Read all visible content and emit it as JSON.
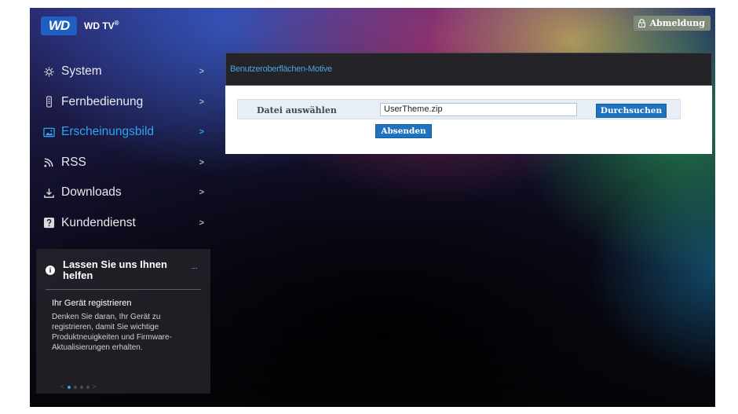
{
  "header": {
    "logo_text": "WD",
    "brand": "WD TV",
    "brand_mark": "®",
    "logout_label": "Abmeldung",
    "logout_icon": "lock-icon"
  },
  "nav": {
    "items": [
      {
        "label": "System",
        "icon": "gear-icon",
        "active": false
      },
      {
        "label": "Fernbedienung",
        "icon": "remote-icon",
        "active": false
      },
      {
        "label": "Erscheinungsbild",
        "icon": "image-icon",
        "active": true
      },
      {
        "label": "RSS",
        "icon": "rss-icon",
        "active": false
      },
      {
        "label": "Downloads",
        "icon": "download-icon",
        "active": false
      },
      {
        "label": "Kundendienst",
        "icon": "help-icon",
        "active": false
      }
    ],
    "chevron": ">"
  },
  "help_box": {
    "title": "Lassen Sie uns Ihnen helfen",
    "more": "...",
    "subtitle": "Ihr Gerät registrieren",
    "body": "Denken Sie daran, Ihr Gerät zu registrieren, damit Sie wichtige Produktneuigkeiten und Firmware-Aktualisierungen erhalten.",
    "pager_prev": "<",
    "pager_next": ">",
    "pager_pages": 4,
    "pager_current": 1
  },
  "panel": {
    "title": "Benutzeroberflächen-Motive",
    "file_label": "Datei auswählen",
    "file_value": "UserTheme.zip",
    "browse_label": "Durchsuchen",
    "submit_label": "Absenden"
  },
  "colors": {
    "accent": "#2fa3ef",
    "button": "#1f72bf",
    "logo": "#1f5fc2"
  }
}
